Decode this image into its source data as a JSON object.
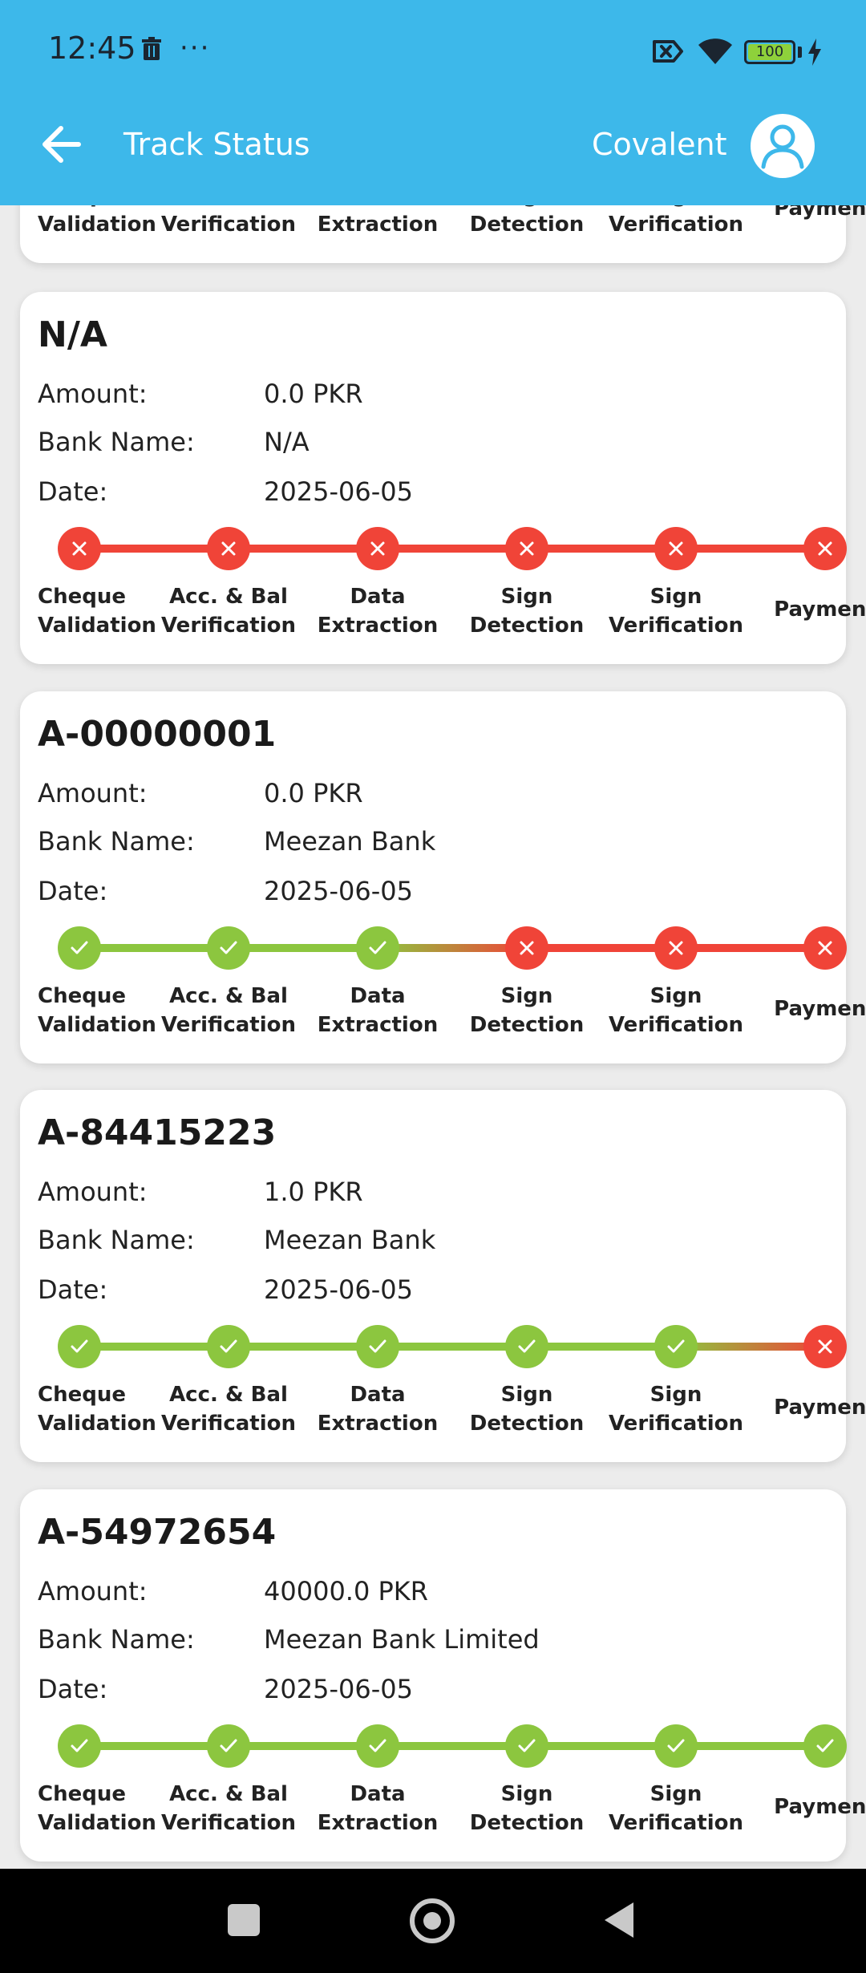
{
  "status_bar": {
    "time": "12:45",
    "dots": "···",
    "battery_level": "100",
    "icons": [
      "trash-icon",
      "more-dots-icon",
      "sim-off-icon",
      "wifi-icon",
      "battery-icon",
      "charging-icon"
    ]
  },
  "app_bar": {
    "title": "Track Status",
    "account_name": "Covalent",
    "back_icon": "arrow-left-icon",
    "avatar_icon": "user-avatar-icon"
  },
  "colors": {
    "app_bar": "#3db8ea",
    "success": "#8cc63f",
    "failure": "#f04438",
    "card": "#ffffff",
    "background": "#ececec"
  },
  "labels": {
    "amount": "Amount:",
    "bank_name": "Bank Name:",
    "date": "Date:"
  },
  "steps": [
    [
      "Cheque",
      "Validation"
    ],
    [
      "Acc. & Bal",
      "Verification"
    ],
    [
      "Data",
      "Extraction"
    ],
    [
      "Sign",
      "Detection"
    ],
    [
      "Sign",
      "Verification"
    ],
    [
      "Payment",
      ""
    ]
  ],
  "cards": [
    {
      "id": "partial",
      "title": "",
      "amount": "",
      "bank_name": "",
      "date": "",
      "status": [
        false,
        false,
        false,
        false,
        false,
        false
      ]
    },
    {
      "id": "na",
      "title": "N/A",
      "amount": "0.0 PKR",
      "bank_name": "N/A",
      "date": "2025-06-05",
      "status": [
        false,
        false,
        false,
        false,
        false,
        false
      ]
    },
    {
      "id": "a00000001",
      "title": "A-00000001",
      "amount": "0.0 PKR",
      "bank_name": "Meezan Bank",
      "date": "2025-06-05",
      "status": [
        true,
        true,
        true,
        false,
        false,
        false
      ]
    },
    {
      "id": "a84415223",
      "title": "A-84415223",
      "amount": "1.0 PKR",
      "bank_name": "Meezan Bank",
      "date": "2025-06-05",
      "status": [
        true,
        true,
        true,
        true,
        true,
        false
      ]
    },
    {
      "id": "a54972654",
      "title": "A-54972654",
      "amount": "40000.0 PKR",
      "bank_name": "Meezan Bank Limited",
      "date": "2025-06-05",
      "status": [
        true,
        true,
        true,
        true,
        true,
        true
      ]
    }
  ],
  "nav_bar": {
    "icons": [
      "recents-square-icon",
      "home-circle-icon",
      "back-triangle-icon"
    ]
  }
}
